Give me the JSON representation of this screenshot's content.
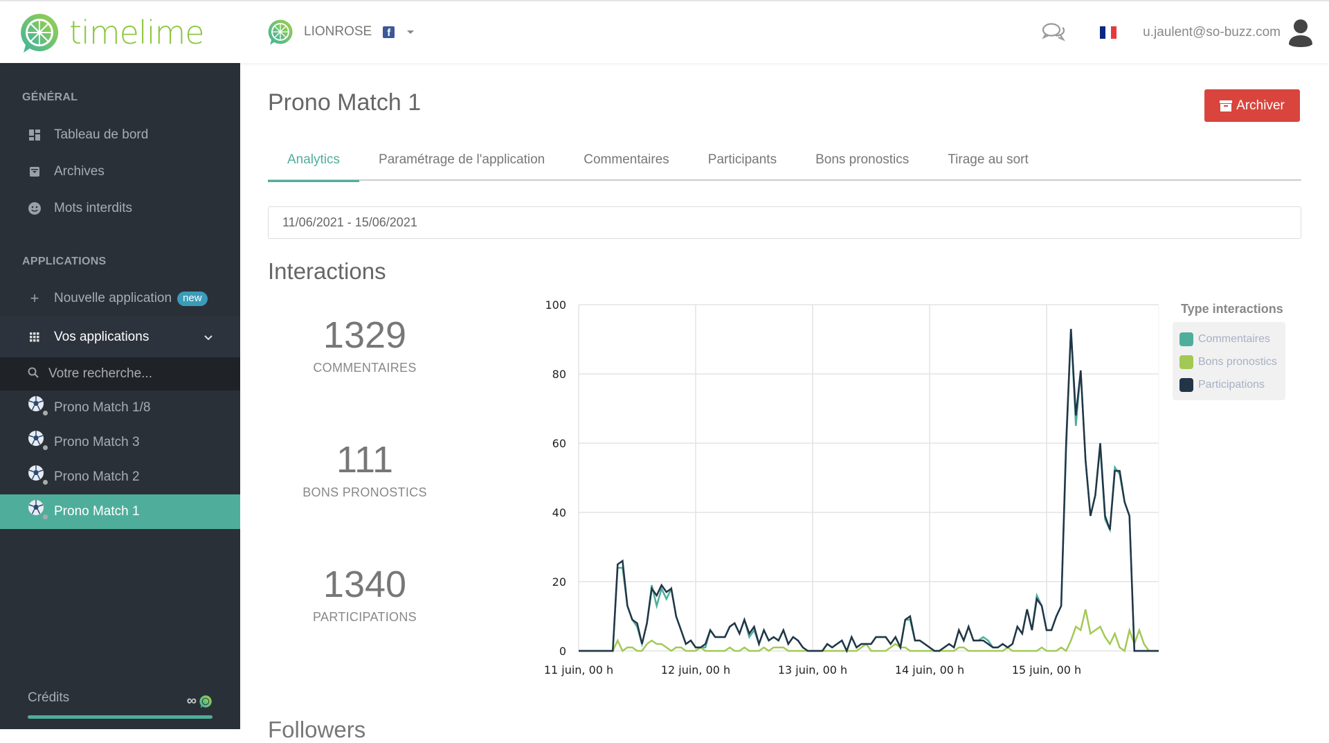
{
  "header": {
    "logo_text": "timelime",
    "account_name": "LIONROSE",
    "network_icon": "facebook-icon",
    "user_email": "u.jaulent@so-buzz.com",
    "language_flag": "fr"
  },
  "colors": {
    "brand_green": "#8cc63f",
    "accent_teal": "#4fae9b",
    "archive_red": "#d9453d",
    "sidebar_bg": "#2a3038",
    "badge_blue": "#3a9cb8",
    "flag_blue": "#0d2680",
    "flag_red": "#e8383d"
  },
  "sidebar": {
    "general_title": "GÉNÉRAL",
    "general_items": [
      {
        "label": "Tableau de bord",
        "icon": "dashboard-icon"
      },
      {
        "label": "Archives",
        "icon": "archive-icon"
      },
      {
        "label": "Mots interdits",
        "icon": "smiley-icon"
      }
    ],
    "applications_title": "APPLICATIONS",
    "new_app_label": "Nouvelle application",
    "new_badge": "new",
    "your_apps_label": "Vos applications",
    "search_placeholder": "Votre recherche...",
    "apps": [
      {
        "label": "Prono Match 1/8",
        "active": false
      },
      {
        "label": "Prono Match 3",
        "active": false
      },
      {
        "label": "Prono Match 2",
        "active": false
      },
      {
        "label": "Prono Match 1",
        "active": true
      }
    ],
    "credits_label": "Crédits",
    "credits_value": "∞",
    "credits_progress_percent": 100
  },
  "main": {
    "title": "Prono Match 1",
    "archive_button": "Archiver",
    "tabs": [
      {
        "label": "Analytics",
        "active": true
      },
      {
        "label": "Paramétrage de l'application",
        "active": false
      },
      {
        "label": "Commentaires",
        "active": false
      },
      {
        "label": "Participants",
        "active": false
      },
      {
        "label": "Bons pronostics",
        "active": false
      },
      {
        "label": "Tirage au sort",
        "active": false
      }
    ],
    "date_range": "11/06/2021 - 15/06/2021",
    "interactions_title": "Interactions",
    "stats": [
      {
        "value": "1329",
        "label": "COMMENTAIRES"
      },
      {
        "value": "111",
        "label": "BONS PRONOSTICS"
      },
      {
        "value": "1340",
        "label": "PARTICIPATIONS"
      }
    ],
    "next_section_title": "Followers"
  },
  "chart_data": {
    "type": "line",
    "title": "",
    "xlabel": "",
    "ylabel": "",
    "ylim": [
      0,
      100
    ],
    "yticks": [
      0,
      20,
      40,
      60,
      80,
      100
    ],
    "x_tick_labels": [
      "11 juin, 00 h",
      "12 juin, 00 h",
      "13 juin, 00 h",
      "14 juin, 00 h",
      "15 juin, 00 h"
    ],
    "x_unit": "hour index from 11 juin 00 h",
    "x_max_hours": 119,
    "grid": true,
    "legend_title": "Type interactions",
    "legend_position": "right",
    "series": [
      {
        "name": "Commentaires",
        "color": "#4fae9b",
        "values": [
          0,
          0,
          0,
          0,
          0,
          0,
          0,
          0,
          24,
          24,
          13,
          9,
          7,
          2,
          8,
          19,
          13,
          18,
          15,
          18,
          10,
          6,
          2,
          3,
          1,
          1,
          1,
          6,
          4,
          4,
          4,
          7,
          8,
          5,
          9,
          4,
          6,
          2,
          6,
          3,
          4,
          3,
          6,
          2,
          4,
          3,
          1,
          0,
          0,
          0,
          0,
          2,
          1,
          2,
          3,
          0,
          4,
          1,
          2,
          2,
          2,
          4,
          4,
          4,
          2,
          4,
          1,
          9,
          9,
          3,
          3,
          2,
          1,
          0,
          0,
          1,
          2,
          1,
          6,
          3,
          7,
          3,
          3,
          4,
          3,
          1,
          1,
          2,
          1,
          2,
          7,
          5,
          12,
          6,
          16,
          13,
          6,
          6,
          10,
          13,
          58,
          93,
          65,
          81,
          55,
          39,
          45,
          59,
          38,
          35,
          53,
          51,
          43,
          39,
          0,
          0,
          0,
          0,
          0,
          0
        ],
        "total": 1329
      },
      {
        "name": "Bons pronostics",
        "color": "#a3c955",
        "values": [
          0,
          0,
          0,
          0,
          0,
          0,
          0,
          0,
          3,
          0,
          1,
          1,
          0,
          0,
          2,
          3,
          2,
          2,
          1,
          0,
          1,
          1,
          0,
          0,
          0,
          1,
          0,
          0,
          0,
          0,
          0,
          1,
          0,
          0,
          1,
          0,
          0,
          0,
          1,
          0,
          1,
          1,
          1,
          0,
          0,
          0,
          0,
          0,
          0,
          0,
          0,
          0,
          0,
          0,
          0,
          0,
          0,
          0,
          1,
          2,
          0,
          0,
          0,
          0,
          1,
          2,
          1,
          1,
          0,
          0,
          0,
          0,
          0,
          0,
          0,
          0,
          0,
          0,
          1,
          1,
          0,
          0,
          0,
          0,
          0,
          0,
          0,
          0,
          1,
          0,
          0,
          0,
          0,
          0,
          0,
          1,
          0,
          0,
          0,
          1,
          0,
          3,
          7,
          6,
          12,
          5,
          6,
          7,
          4,
          2,
          5,
          1,
          0,
          6,
          2,
          6,
          2,
          0,
          0,
          0
        ],
        "total": 111
      },
      {
        "name": "Participations",
        "color": "#223547",
        "values": [
          0,
          0,
          0,
          0,
          0,
          0,
          0,
          0,
          25,
          26,
          13,
          9,
          8,
          2,
          8,
          18,
          16,
          19,
          17,
          18,
          10,
          6,
          2,
          3,
          1,
          1,
          2,
          6,
          4,
          4,
          4,
          7,
          8,
          5,
          9,
          5,
          7,
          2,
          6,
          3,
          4,
          3,
          6,
          2,
          4,
          3,
          1,
          0,
          0,
          0,
          0,
          2,
          1,
          2,
          3,
          0,
          4,
          1,
          2,
          2,
          2,
          4,
          4,
          4,
          2,
          4,
          1,
          9,
          10,
          3,
          3,
          2,
          1,
          0,
          0,
          1,
          2,
          1,
          6,
          3,
          7,
          3,
          3,
          3,
          2,
          1,
          1,
          2,
          1,
          2,
          7,
          5,
          12,
          6,
          15,
          13,
          6,
          6,
          10,
          13,
          60,
          93,
          68,
          81,
          55,
          39,
          45,
          60,
          39,
          35,
          52,
          52,
          43,
          39,
          0,
          0,
          0,
          0,
          0,
          0
        ],
        "total": 1340
      }
    ]
  }
}
